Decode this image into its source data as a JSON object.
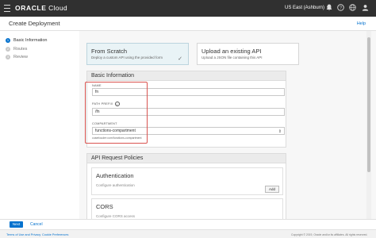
{
  "topbar": {
    "logo_brand": "ORACLE",
    "logo_product": "Cloud",
    "region": "US East (Ashburn)",
    "icons": [
      "menu-icon",
      "chevron-down-icon",
      "bell-icon",
      "help-icon",
      "globe-icon",
      "user-icon"
    ]
  },
  "titlebar": {
    "title": "Create Deployment",
    "help": "Help"
  },
  "steps": [
    {
      "num": "1",
      "label": "Basic Information",
      "active": true
    },
    {
      "num": "2",
      "label": "Routes",
      "active": false
    },
    {
      "num": "3",
      "label": "Review",
      "active": false
    }
  ],
  "cards": [
    {
      "title": "From Scratch",
      "desc": "Deploy a custom API using the provided form",
      "selected": true
    },
    {
      "title": "Upload an existing API",
      "desc": "Upload a JSON file containing this API",
      "selected": false
    }
  ],
  "basic_info": {
    "heading": "Basic Information",
    "name_label": "NAME",
    "name_value": "fn",
    "prefix_label": "PATH PREFIX",
    "prefix_value": "/fn",
    "compartment_label": "COMPARTMENT",
    "compartment_value": "functions-compartment",
    "compartment_help": "cuserlouder:com/functions-compartment"
  },
  "policies": {
    "heading": "API Request Policies",
    "auth_title": "Authentication",
    "auth_desc": "Configure authentication",
    "add_label": "Add",
    "cors_title": "CORS",
    "cors_desc": "Configure CORS access"
  },
  "actions": {
    "next": "Next",
    "cancel": "Cancel"
  },
  "footer": {
    "terms": "Terms of Use and Privacy",
    "cookies": "Cookie Preferences",
    "copyright": "Copyright © 2019, Oracle and/or its affiliates. All rights reserved."
  }
}
